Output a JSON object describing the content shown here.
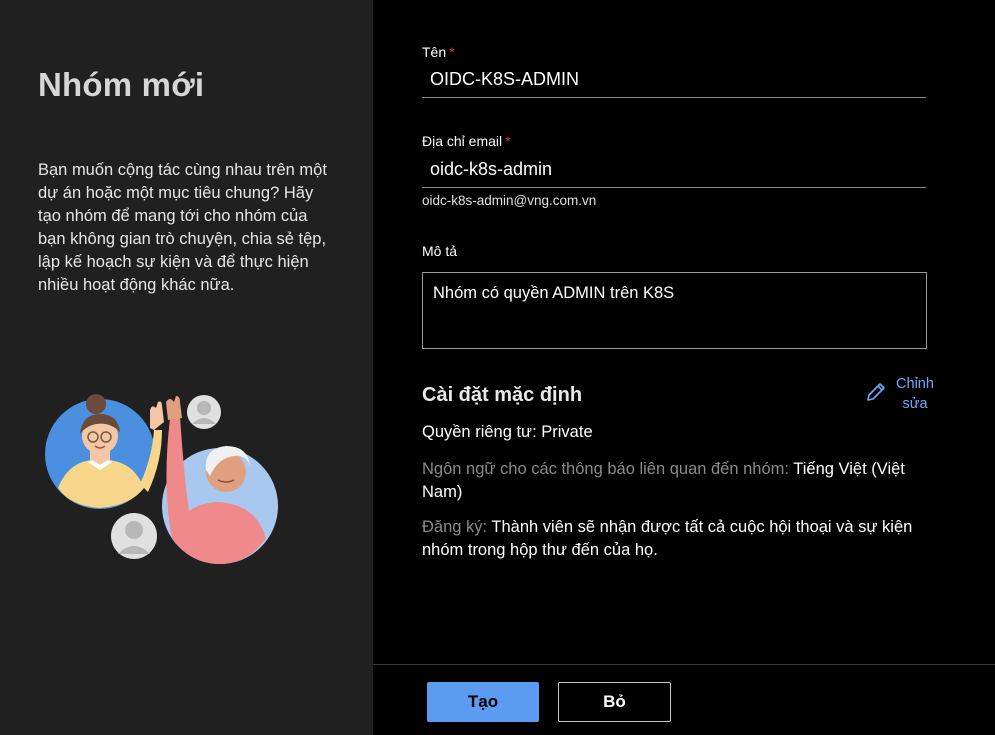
{
  "intro": {
    "title": "Nhóm mới",
    "description": "Bạn muốn cộng tác cùng nhau trên một dự án hoặc một mục tiêu chung? Hãy tạo nhóm để mang tới cho nhóm của bạn không gian trò chuyện, chia sẻ tệp, lập kế hoạch sự kiện và để thực hiện nhiều hoạt động khác nữa."
  },
  "form": {
    "name_label": "Tên",
    "name_value": "OIDC-K8S-ADMIN",
    "email_label": "Địa chỉ email",
    "email_value": "oidc-k8s-admin",
    "email_full": "oidc-k8s-admin@vng.com.vn",
    "desc_label": "Mô tả",
    "desc_value": "Nhóm có quyền ADMIN trên K8S",
    "required_mark": "*"
  },
  "defaults": {
    "title": "Cài đặt mặc định",
    "edit_label": "Chỉnh sửa",
    "privacy": "Quyền riêng tư: Private",
    "language_label": "Ngôn ngữ cho các thông báo liên quan đến nhóm:",
    "language_value": "Tiếng Việt (Việt Nam)",
    "subscription_label": "Đăng ký:",
    "subscription_value": "Thành viên sẽ nhận được tất cả cuộc hội thoại và sự kiện nhóm trong hộp thư đến của họ."
  },
  "actions": {
    "create_label": "Tạo",
    "cancel_label": "Bỏ"
  },
  "colors": {
    "accent": "#5b9bf0",
    "link": "#6ea8fe",
    "required": "#d13438"
  }
}
